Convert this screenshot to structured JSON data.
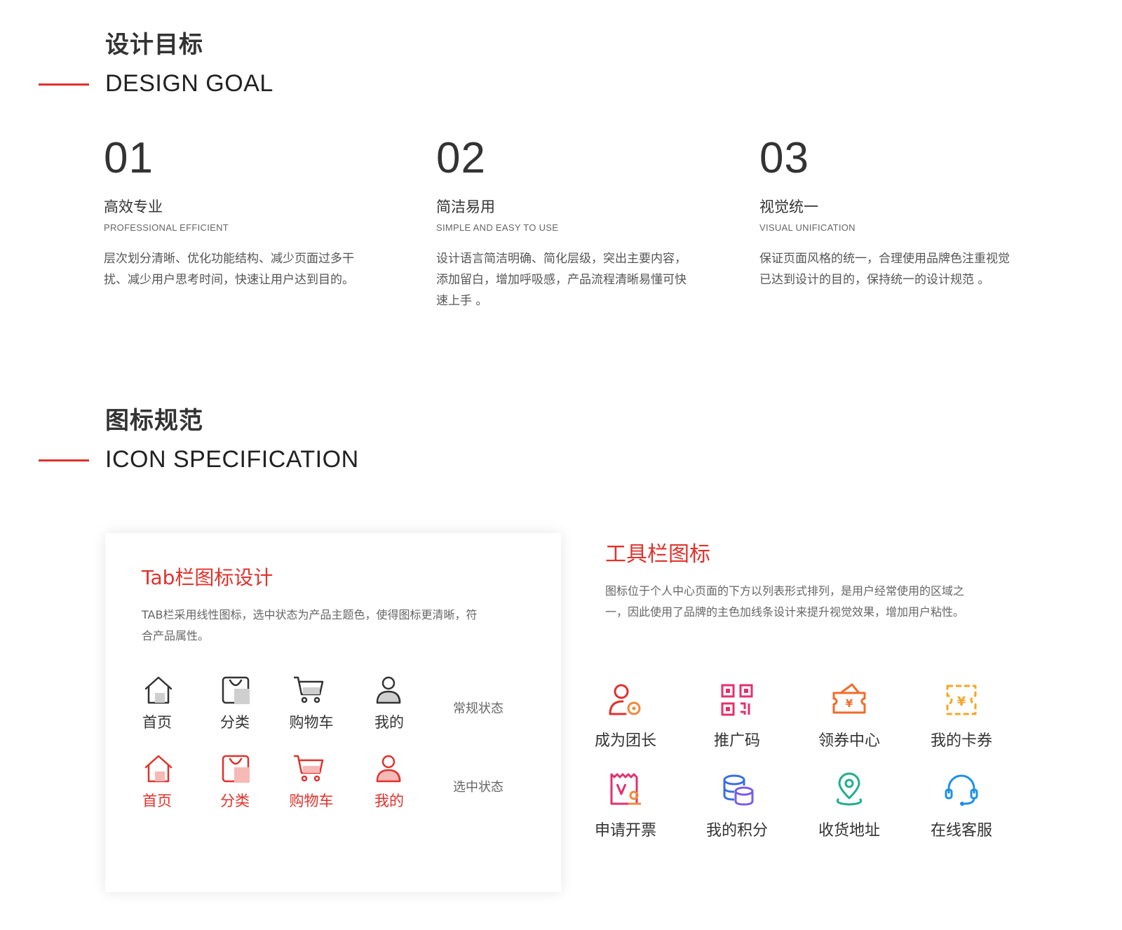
{
  "design_goal": {
    "title_cn": "设计目标",
    "title_en": "DESIGN GOAL",
    "items": [
      {
        "num": "01",
        "title": "高效专业",
        "subtitle": "PROFESSIONAL EFFICIENT",
        "desc": "层次划分清晰、优化功能结构、减少页面过多干扰、减少用户思考时间，快速让用户达到目的。"
      },
      {
        "num": "02",
        "title": "简洁易用",
        "subtitle": "SIMPLE AND EASY TO USE",
        "desc": "设计语言简洁明确、简化层级，突出主要内容，添加留白，增加呼吸感，产品流程清晰易懂可快速上手 。"
      },
      {
        "num": "03",
        "title": "视觉统一",
        "subtitle": "VISUAL UNIFICATION",
        "desc": "保证页面风格的统一，合理使用品牌色注重视觉已达到设计的目的，保持统一的设计规范 。"
      }
    ]
  },
  "icon_spec": {
    "title_cn": "图标规范",
    "title_en": "ICON SPECIFICATION"
  },
  "tab_card": {
    "title": "Tab栏图标设计",
    "desc": "TAB栏采用线性图标，选中状态为产品主题色，使得图标更清晰，符合产品属性。",
    "normal_state": "常规状态",
    "active_state": "选中状态",
    "tabs": [
      {
        "label": "首页",
        "icon": "home-icon"
      },
      {
        "label": "分类",
        "icon": "bag-icon"
      },
      {
        "label": "购物车",
        "icon": "cart-icon"
      },
      {
        "label": "我的",
        "icon": "user-icon"
      }
    ]
  },
  "toolbar": {
    "title": "工具栏图标",
    "desc": "图标位于个人中心页面的下方以列表形式排列，是用户经常使用的区域之一，因此使用了品牌的主色加线条设计来提升视觉效果，增加用户粘性。",
    "items": [
      {
        "label": "成为团长",
        "icon": "user-gear-icon"
      },
      {
        "label": "推广码",
        "icon": "qr-code-icon"
      },
      {
        "label": "领券中心",
        "icon": "coupon-center-icon"
      },
      {
        "label": "我的卡券",
        "icon": "ticket-icon"
      },
      {
        "label": "申请开票",
        "icon": "invoice-icon"
      },
      {
        "label": "我的积分",
        "icon": "points-icon"
      },
      {
        "label": "收货地址",
        "icon": "location-icon"
      },
      {
        "label": "在线客服",
        "icon": "headset-icon"
      }
    ]
  },
  "colors": {
    "accent": "#e0322c",
    "text": "#333333",
    "muted": "#666666"
  }
}
